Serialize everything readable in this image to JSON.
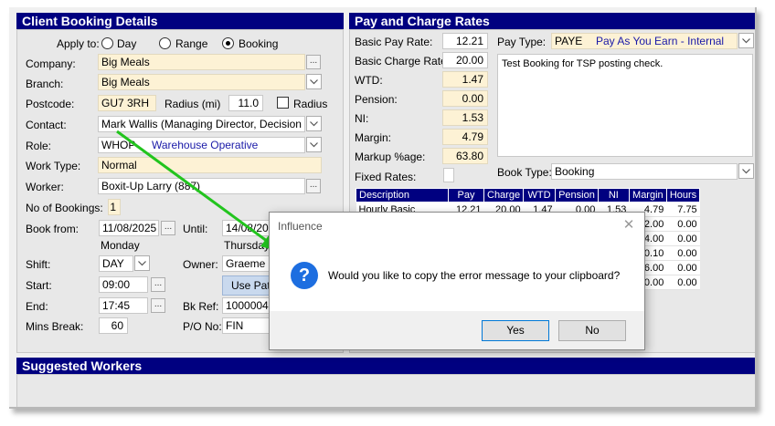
{
  "client": {
    "header": "Client Booking Details",
    "apply_to": {
      "label": "Apply to:",
      "options": [
        "Day",
        "Range",
        "Booking"
      ],
      "selected": "Booking"
    },
    "company": {
      "label": "Company:",
      "value": "Big Meals"
    },
    "branch": {
      "label": "Branch:",
      "value": "Big Meals"
    },
    "postcode": {
      "label": "Postcode:",
      "value": "GU7 3RH"
    },
    "radius": {
      "label": "Radius (mi)",
      "value": "11.0",
      "check_label": "Radius"
    },
    "contact": {
      "label": "Contact:",
      "value": "Mark Wallis (Managing Director, Decision Make"
    },
    "role": {
      "label": "Role:",
      "code": "WHOP",
      "desc": "Warehouse Operative"
    },
    "work_type": {
      "label": "Work Type:",
      "value": "Normal"
    },
    "worker": {
      "label": "Worker:",
      "value": "Boxit-Up Larry (887)"
    },
    "no_bookings": {
      "label": "No of Bookings:",
      "value": "1"
    },
    "book_from": {
      "label": "Book from:",
      "value": "11/08/2025",
      "day": "Monday"
    },
    "until": {
      "label": "Until:",
      "value": "14/08/2025",
      "day": "Thursday"
    },
    "shift": {
      "label": "Shift:",
      "value": "DAY"
    },
    "owner": {
      "label": "Owner:",
      "value": "Graeme on"
    },
    "use_pattern": "Use Patte",
    "start": {
      "label": "Start:",
      "value": "09:00"
    },
    "end": {
      "label": "End:",
      "value": "17:45"
    },
    "bk_ref": {
      "label": "Bk Ref:",
      "value": "10000045"
    },
    "mins_break": {
      "label": "Mins Break:",
      "value": "60"
    },
    "po_no": {
      "label": "P/O No:",
      "value": "FIN"
    }
  },
  "pay": {
    "header": "Pay and Charge Rates",
    "basic_pay_rate": {
      "label": "Basic Pay Rate:",
      "value": "12.21"
    },
    "basic_charge_rate": {
      "label": "Basic Charge Rate:",
      "value": "20.00"
    },
    "wtd": {
      "label": "WTD:",
      "value": "1.47"
    },
    "pension": {
      "label": "Pension:",
      "value": "0.00"
    },
    "ni": {
      "label": "NI:",
      "value": "1.53"
    },
    "margin": {
      "label": "Margin:",
      "value": "4.79"
    },
    "markup": {
      "label": "Markup %age:",
      "value": "63.80"
    },
    "fixed_rates": {
      "label": "Fixed Rates:"
    },
    "pay_type": {
      "label": "Pay Type:",
      "code": "PAYE",
      "desc": "Pay As You Earn - Internal"
    },
    "memo": "Test Booking for TSP posting check.",
    "book_type": {
      "label": "Book Type:",
      "value": "Booking"
    },
    "table": {
      "columns": [
        "Description",
        "Pay",
        "Charge",
        "WTD",
        "Pension",
        "NI",
        "Margin",
        "Hours"
      ],
      "rows": [
        [
          "Hourly Basic",
          "12.21",
          "20.00",
          "1.47",
          "0.00",
          "1.53",
          "4.79",
          "7.75"
        ],
        [
          "",
          "",
          "",
          "",
          "",
          "",
          "12.00",
          "0.00"
        ],
        [
          "",
          "",
          "",
          "",
          "",
          "",
          "14.00",
          "0.00"
        ],
        [
          "",
          "",
          "",
          "",
          "",
          "",
          "10.10",
          "0.00"
        ],
        [
          "",
          "",
          "",
          "",
          "",
          "",
          "16.00",
          "0.00"
        ],
        [
          "",
          "",
          "",
          "",
          "",
          "",
          "0.00",
          "0.00"
        ]
      ]
    }
  },
  "suggested": {
    "header": "Suggested Workers"
  },
  "dialog": {
    "title": "Influence",
    "message": "Would you like to copy the error message to your clipboard?",
    "yes": "Yes",
    "no": "No",
    "icon_glyph": "?"
  },
  "colors": {
    "header_bg": "#000080",
    "field_bg": "#fdf2d5",
    "arrow": "#22c41e",
    "dialog_icon": "#1d6ee0"
  }
}
